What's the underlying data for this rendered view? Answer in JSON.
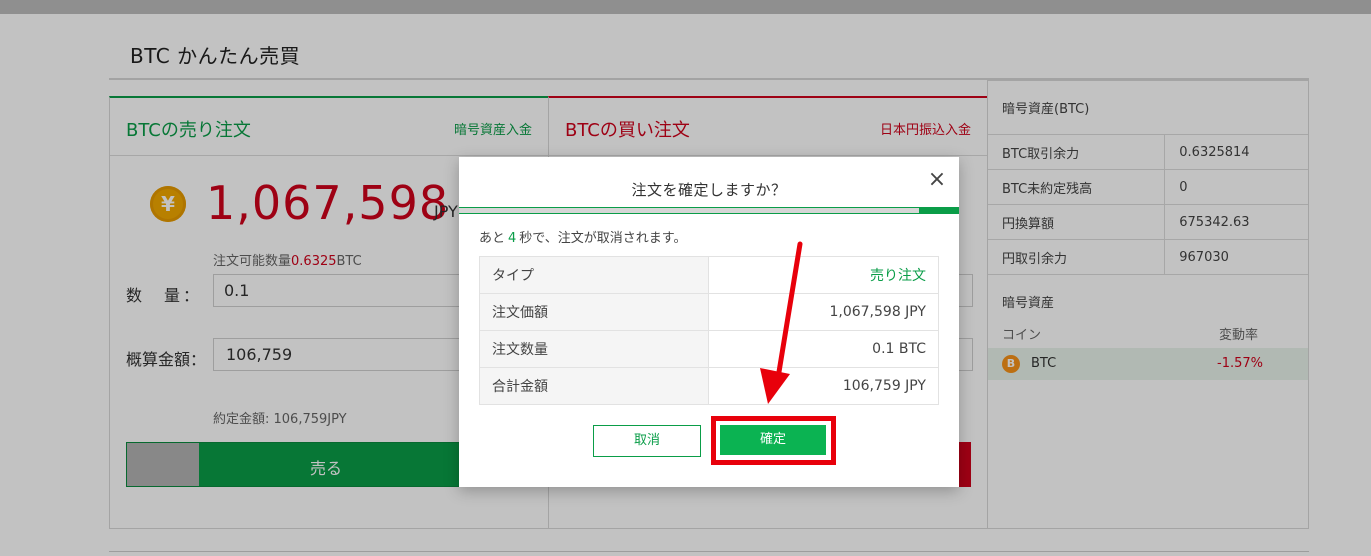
{
  "page": {
    "title": "BTC かんたん売買"
  },
  "sell_panel": {
    "title": "BTCの売り注文",
    "deposit_link": "暗号資産入金",
    "currency_icon": "¥",
    "price": "1,067,598",
    "price_unit": "JPY",
    "available_label": "注文可能数量",
    "available_value": "0.6325",
    "available_unit": "BTC",
    "quantity_label": "数　量：",
    "quantity_value": "0.1",
    "estimate_label": "概算金額：",
    "estimate_value": "106,759",
    "contract_text": "約定金額: 106,759JPY",
    "sell_button": "売る"
  },
  "buy_panel": {
    "title": "BTCの買い注文",
    "deposit_link": "日本円振込入金"
  },
  "side_panel": {
    "title": "暗号資産(BTC)",
    "rows": [
      {
        "label": "BTC取引余力",
        "value": "0.6325814"
      },
      {
        "label": "BTC未約定残高",
        "value": "0"
      },
      {
        "label": "円換算額",
        "value": "675342.63"
      },
      {
        "label": "円取引余力",
        "value": "967030"
      }
    ],
    "assets_title": "暗号資産",
    "col_coin": "コイン",
    "col_change": "変動率",
    "asset": {
      "icon": "B",
      "name": "BTC",
      "change": "-1.57%"
    }
  },
  "modal": {
    "title": "注文を確定しますか？",
    "close_glyph": "×",
    "countdown_prefix": "あと",
    "countdown_seconds": "4",
    "countdown_suffix": "秒で、注文が取消されます。",
    "progress_remaining_fraction": 0.08,
    "rows": [
      {
        "label": "タイプ",
        "value": "売り注文"
      },
      {
        "label": "注文価額",
        "value": "1,067,598 JPY"
      },
      {
        "label": "注文数量",
        "value": "0.1 BTC"
      },
      {
        "label": "合計金額",
        "value": "106,759 JPY"
      }
    ],
    "cancel_button": "取消",
    "confirm_button": "確定"
  },
  "colors": {
    "sell_green": "#0a9d48",
    "buy_red": "#d0021b",
    "confirm_green": "#0bb352",
    "annotation_red": "#e8000b"
  }
}
